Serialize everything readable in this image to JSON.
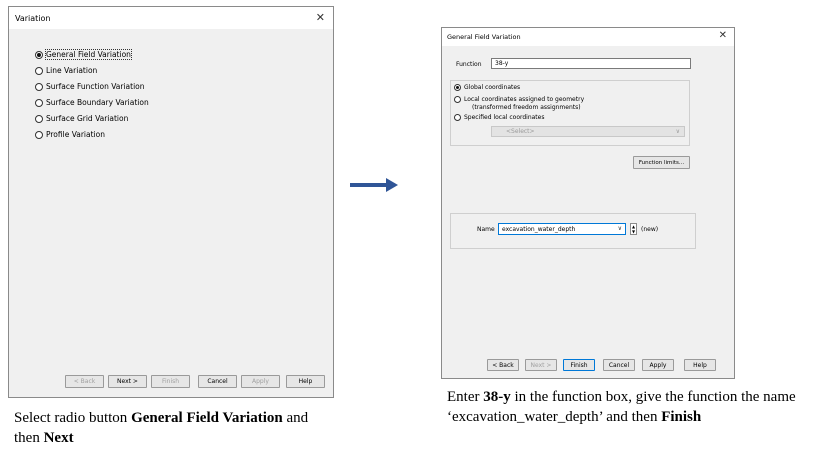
{
  "dialog1": {
    "title": "Variation",
    "options": [
      {
        "label": "General Field Variation",
        "selected": true
      },
      {
        "label": "Line Variation",
        "selected": false
      },
      {
        "label": "Surface Function Variation",
        "selected": false
      },
      {
        "label": "Surface Boundary Variation",
        "selected": false
      },
      {
        "label": "Surface Grid Variation",
        "selected": false
      },
      {
        "label": "Profile Variation",
        "selected": false
      }
    ],
    "buttons": {
      "back": "< Back",
      "next": "Next >",
      "finish": "Finish",
      "cancel": "Cancel",
      "apply": "Apply",
      "help": "Help"
    }
  },
  "dialog2": {
    "title": "General Field Variation",
    "function_label": "Function",
    "function_value": "38-y",
    "coord_options": [
      {
        "label": "Global coordinates",
        "selected": true
      },
      {
        "label": "Local coordinates assigned to geometry",
        "selected": false
      },
      {
        "label": "Specified local coordinates",
        "selected": false
      }
    ],
    "coord_sublabel": "(transformed freedom assignments)",
    "select_placeholder": "<Select>",
    "function_limits_button": "Function limits...",
    "name_label": "Name",
    "name_value": "excavation_water_depth",
    "new_label": "(new)",
    "buttons": {
      "back": "< Back",
      "next": "Next >",
      "finish": "Finish",
      "cancel": "Cancel",
      "apply": "Apply",
      "help": "Help"
    }
  },
  "captions": {
    "left": {
      "part1": "Select radio button ",
      "bold1": "General Field Variation",
      "part2": " and then ",
      "bold2": "Next"
    },
    "right": {
      "part1": "Enter ",
      "bold1": "38-y",
      "part2": " in the function box, give the function the name ‘excavation_water_depth’ and then ",
      "bold2": "Finish"
    }
  },
  "colors": {
    "arrow": "#2f5597",
    "focus_border": "#0078d7",
    "dialog_bg": "#f0f0f0"
  },
  "icons": {
    "close": "close-icon",
    "arrow": "right-arrow-icon",
    "dropdown": "chevron-down-icon",
    "spinner": "spinner-arrows-icon"
  }
}
